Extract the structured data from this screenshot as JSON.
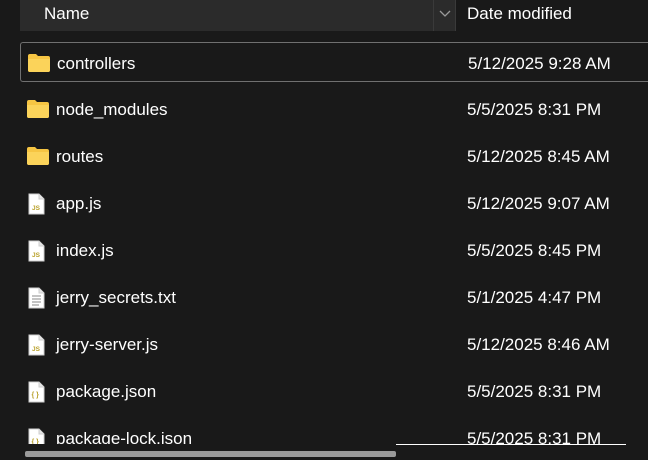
{
  "header": {
    "name_label": "Name",
    "date_label": "Date modified"
  },
  "files": [
    {
      "name": "controllers",
      "date": "5/12/2025 9:28 AM",
      "icon": "folder-icon",
      "selected": true
    },
    {
      "name": "node_modules",
      "date": "5/5/2025 8:31 PM",
      "icon": "folder-icon"
    },
    {
      "name": "routes",
      "date": "5/12/2025 8:45 AM",
      "icon": "folder-icon"
    },
    {
      "name": "app.js",
      "date": "5/12/2025 9:07 AM",
      "icon": "js-file-icon"
    },
    {
      "name": "index.js",
      "date": "5/5/2025 8:45 PM",
      "icon": "js-file-icon"
    },
    {
      "name": "jerry_secrets.txt",
      "date": "5/1/2025 4:47 PM",
      "icon": "text-file-icon"
    },
    {
      "name": "jerry-server.js",
      "date": "5/12/2025 8:46 AM",
      "icon": "js-file-icon"
    },
    {
      "name": "package.json",
      "date": "5/5/2025 8:31 PM",
      "icon": "json-file-icon"
    },
    {
      "name": "package-lock.json",
      "date": "5/5/2025 8:31 PM",
      "icon": "json-file-icon"
    }
  ],
  "colors": {
    "background": "#191919",
    "header_bg": "#2b2b2b",
    "folder": "#f6c543"
  }
}
